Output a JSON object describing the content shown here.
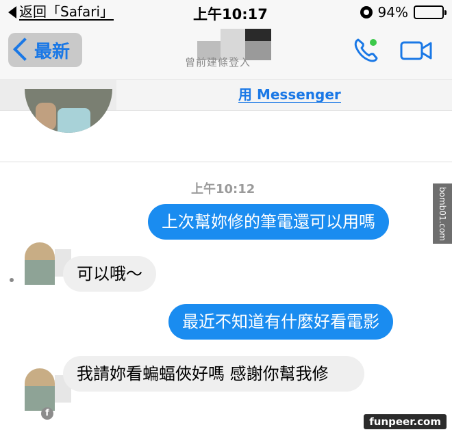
{
  "status_bar": {
    "back_text": "返回「Safari」",
    "time": "上午10:17",
    "battery_percent": "94%",
    "battery_level": 0.94
  },
  "nav": {
    "back_label": "最新",
    "subtitle": "曾前建條登入"
  },
  "banner": {
    "link_text": "用 Messenger"
  },
  "chat": {
    "timestamp": "上午10:12",
    "messages": [
      {
        "from": "me",
        "text": "上次幫妳修的筆電還可以用嗎"
      },
      {
        "from": "them",
        "text": "可以哦～"
      },
      {
        "from": "me",
        "text": "最近不知道有什麼好看電影"
      },
      {
        "from": "them",
        "text": "我請妳看蝙蝠俠好嗎 感謝你幫我修"
      }
    ]
  },
  "side_tag": "bomb01.com",
  "watermark": "funpeer.com",
  "icons": [
    "phone-icon",
    "video-icon",
    "alarm-icon",
    "battery-icon",
    "back-chevron-icon"
  ],
  "colors": {
    "accent": "#1a78e6",
    "outgoing_bubble": "#1a8cf0",
    "incoming_bubble": "#efefef",
    "online_dot": "#3cc94a"
  }
}
